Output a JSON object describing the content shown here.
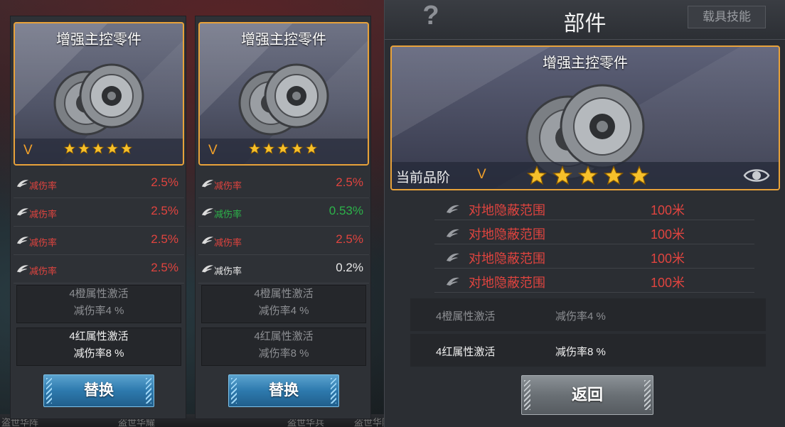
{
  "colors": {
    "accent_orange": "#e8a23a",
    "grade_orange": "#f3a12a",
    "attr_red": "#e0443f",
    "attr_green": "#2db34a",
    "replace_blue": "#2d79ad",
    "back_gray": "#6a7075"
  },
  "background": {
    "bottom_labels": [
      "盗世华阵",
      "盗世华耀",
      "盗世华兵",
      "盗世华阵"
    ]
  },
  "cards": [
    {
      "item_name": "增强主控零件",
      "grade": "V",
      "stars": 5,
      "attributes": [
        {
          "label": "减伤率",
          "value": "2.5%",
          "color": "red"
        },
        {
          "label": "减伤率",
          "value": "2.5%",
          "color": "red"
        },
        {
          "label": "减伤率",
          "value": "2.5%",
          "color": "red"
        },
        {
          "label": "减伤率",
          "value": "2.5%",
          "color": "red"
        }
      ],
      "set_bonuses": [
        {
          "name": "4橙属性激活",
          "effect": "减伤率4 %",
          "active": false
        },
        {
          "name": "4红属性激活",
          "effect": "减伤率8 %",
          "active": true
        }
      ],
      "button_label": "替换"
    },
    {
      "item_name": "增强主控零件",
      "grade": "V",
      "stars": 5,
      "attributes": [
        {
          "label": "减伤率",
          "value": "2.5%",
          "color": "red"
        },
        {
          "label": "减伤率",
          "value": "0.53%",
          "color": "green"
        },
        {
          "label": "减伤率",
          "value": "2.5%",
          "color": "red"
        },
        {
          "label": "减伤率",
          "value": "0.2%",
          "color": "white"
        }
      ],
      "set_bonuses": [
        {
          "name": "4橙属性激活",
          "effect": "减伤率4 %",
          "active": false
        },
        {
          "name": "4红属性激活",
          "effect": "减伤率8 %",
          "active": false
        }
      ],
      "button_label": "替换"
    }
  ],
  "panel": {
    "help_label": "?",
    "title": "部件",
    "skill_tab_label": "载具技能",
    "item_name": "增强主控零件",
    "current_grade_label": "当前品阶",
    "grade": "V",
    "stars": 5,
    "attributes": [
      {
        "label": "对地隐蔽范围",
        "value": "100米"
      },
      {
        "label": "对地隐蔽范围",
        "value": "100米"
      },
      {
        "label": "对地隐蔽范围",
        "value": "100米"
      },
      {
        "label": "对地隐蔽范围",
        "value": "100米"
      }
    ],
    "set_bonuses": [
      {
        "name": "4橙属性激活",
        "effect": "减伤率4 %",
        "active": false
      },
      {
        "name": "4红属性激活",
        "effect": "减伤率8 %",
        "active": true
      }
    ],
    "back_label": "返回"
  }
}
